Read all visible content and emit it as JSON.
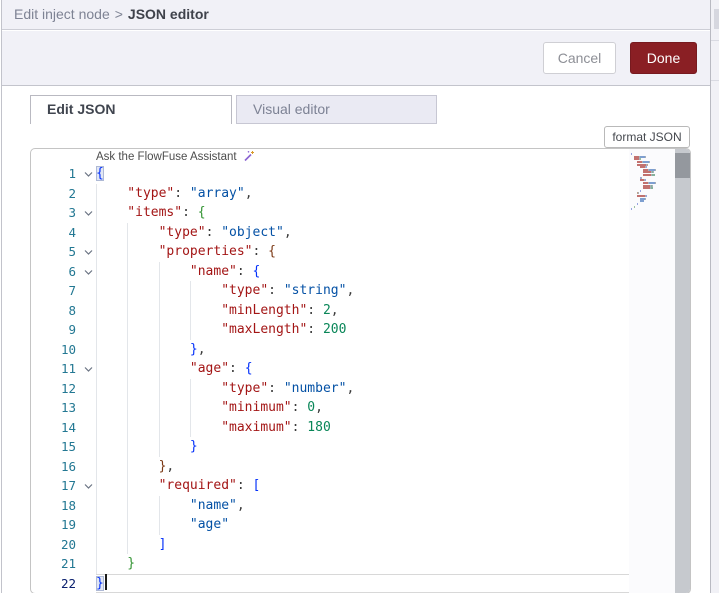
{
  "breadcrumb": {
    "parent": "Edit inject node",
    "separator": ">",
    "current": "JSON editor"
  },
  "buttons": {
    "cancel": "Cancel",
    "done": "Done"
  },
  "tabs": [
    {
      "label": "Edit JSON",
      "active": true
    },
    {
      "label": "Visual editor",
      "active": false
    }
  ],
  "editor": {
    "format_button": "format JSON",
    "assistant_hint": "Ask the FlowFuse Assistant",
    "language": "json",
    "line_count": 22,
    "theme": {
      "key": "#a31515",
      "string": "#0451a5",
      "number": "#098658",
      "punct": "#3b3b3b",
      "bracket_depth1": "#0431fa",
      "bracket_depth2": "#319331",
      "bracket_depth3": "#7b3814",
      "line_number": "#237893",
      "active_line_number": "#0b216f",
      "done_button_bg": "#8a1f24",
      "header_bg": "#f1f1f7",
      "inactive_tab_bg": "#eaeaf3"
    },
    "lines": [
      {
        "n": 1,
        "indent": 0,
        "fold": true,
        "tokens": [
          [
            "bm",
            "{"
          ]
        ]
      },
      {
        "n": 2,
        "indent": 1,
        "tokens": [
          [
            "k",
            "\"type\""
          ],
          [
            "p",
            ": "
          ],
          [
            "s",
            "\"array\""
          ],
          [
            "p",
            ","
          ]
        ]
      },
      {
        "n": 3,
        "indent": 1,
        "fold": true,
        "tokens": [
          [
            "k",
            "\"items\""
          ],
          [
            "p",
            ": "
          ],
          [
            "b2",
            "{"
          ]
        ]
      },
      {
        "n": 4,
        "indent": 2,
        "tokens": [
          [
            "k",
            "\"type\""
          ],
          [
            "p",
            ": "
          ],
          [
            "s",
            "\"object\""
          ],
          [
            "p",
            ","
          ]
        ]
      },
      {
        "n": 5,
        "indent": 2,
        "fold": true,
        "tokens": [
          [
            "k",
            "\"properties\""
          ],
          [
            "p",
            ": "
          ],
          [
            "b3",
            "{"
          ]
        ]
      },
      {
        "n": 6,
        "indent": 3,
        "fold": true,
        "tokens": [
          [
            "k",
            "\"name\""
          ],
          [
            "p",
            ": "
          ],
          [
            "b1",
            "{"
          ]
        ]
      },
      {
        "n": 7,
        "indent": 4,
        "tokens": [
          [
            "k",
            "\"type\""
          ],
          [
            "p",
            ": "
          ],
          [
            "s",
            "\"string\""
          ],
          [
            "p",
            ","
          ]
        ]
      },
      {
        "n": 8,
        "indent": 4,
        "tokens": [
          [
            "k",
            "\"minLength\""
          ],
          [
            "p",
            ": "
          ],
          [
            "n",
            "2"
          ],
          [
            "p",
            ","
          ]
        ]
      },
      {
        "n": 9,
        "indent": 4,
        "tokens": [
          [
            "k",
            "\"maxLength\""
          ],
          [
            "p",
            ": "
          ],
          [
            "n",
            "200"
          ]
        ]
      },
      {
        "n": 10,
        "indent": 3,
        "tokens": [
          [
            "b1",
            "}"
          ],
          [
            "p",
            ","
          ]
        ]
      },
      {
        "n": 11,
        "indent": 3,
        "fold": true,
        "tokens": [
          [
            "k",
            "\"age\""
          ],
          [
            "p",
            ": "
          ],
          [
            "b1",
            "{"
          ]
        ]
      },
      {
        "n": 12,
        "indent": 4,
        "tokens": [
          [
            "k",
            "\"type\""
          ],
          [
            "p",
            ": "
          ],
          [
            "s",
            "\"number\""
          ],
          [
            "p",
            ","
          ]
        ]
      },
      {
        "n": 13,
        "indent": 4,
        "tokens": [
          [
            "k",
            "\"minimum\""
          ],
          [
            "p",
            ": "
          ],
          [
            "n",
            "0"
          ],
          [
            "p",
            ","
          ]
        ]
      },
      {
        "n": 14,
        "indent": 4,
        "tokens": [
          [
            "k",
            "\"maximum\""
          ],
          [
            "p",
            ": "
          ],
          [
            "n",
            "180"
          ]
        ]
      },
      {
        "n": 15,
        "indent": 3,
        "tokens": [
          [
            "b1",
            "}"
          ]
        ]
      },
      {
        "n": 16,
        "indent": 2,
        "tokens": [
          [
            "b3",
            "}"
          ],
          [
            "p",
            ","
          ]
        ]
      },
      {
        "n": 17,
        "indent": 2,
        "fold": true,
        "tokens": [
          [
            "k",
            "\"required\""
          ],
          [
            "p",
            ": "
          ],
          [
            "b1",
            "["
          ]
        ]
      },
      {
        "n": 18,
        "indent": 3,
        "tokens": [
          [
            "s",
            "\"name\""
          ],
          [
            "p",
            ","
          ]
        ]
      },
      {
        "n": 19,
        "indent": 3,
        "tokens": [
          [
            "s",
            "\"age\""
          ]
        ]
      },
      {
        "n": 20,
        "indent": 2,
        "tokens": [
          [
            "b1",
            "]"
          ]
        ]
      },
      {
        "n": 21,
        "indent": 1,
        "tokens": [
          [
            "b2",
            "}"
          ]
        ]
      },
      {
        "n": 22,
        "indent": 0,
        "cur": true,
        "tokens": [
          [
            "bm",
            "}"
          ]
        ]
      }
    ]
  }
}
